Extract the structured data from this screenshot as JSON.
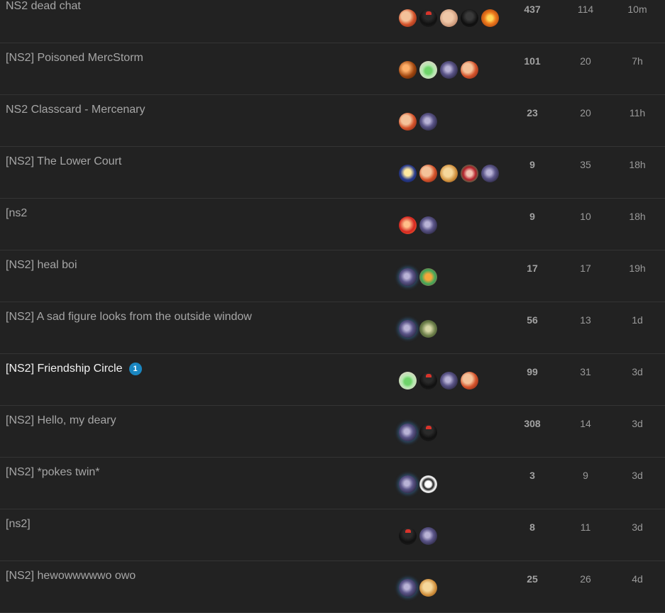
{
  "topics": [
    {
      "title": "NS2 dead chat",
      "badge": "",
      "unread": false,
      "posters": [
        "a",
        "b",
        "c",
        "d",
        "e"
      ],
      "replies": "437",
      "views": "114",
      "activity": "10m"
    },
    {
      "title": "[NS2] Poisoned MercStorm",
      "badge": "",
      "unread": false,
      "posters": [
        "f",
        "g",
        "h",
        "a"
      ],
      "replies": "101",
      "views": "20",
      "activity": "7h"
    },
    {
      "title": "NS2 Classcard - Mercenary",
      "badge": "",
      "unread": false,
      "posters": [
        "a",
        "h"
      ],
      "replies": "23",
      "views": "20",
      "activity": "11h"
    },
    {
      "title": "[NS2] The Lower Court",
      "badge": "",
      "unread": false,
      "posters": [
        "i",
        "a",
        "j",
        "k",
        "h"
      ],
      "replies": "9",
      "views": "35",
      "activity": "18h"
    },
    {
      "title": "[ns2",
      "badge": "",
      "unread": false,
      "posters": [
        "l",
        "h"
      ],
      "replies": "9",
      "views": "10",
      "activity": "18h"
    },
    {
      "title": "[NS2] heal boi",
      "badge": "",
      "unread": false,
      "posters": [
        "h",
        "m"
      ],
      "replies": "17",
      "views": "17",
      "activity": "19h"
    },
    {
      "title": "[NS2] A sad figure looks from the outside window",
      "badge": "",
      "unread": false,
      "posters": [
        "h",
        "n"
      ],
      "replies": "56",
      "views": "13",
      "activity": "1d"
    },
    {
      "title": "[NS2] Friendship Circle",
      "badge": "1",
      "unread": true,
      "posters": [
        "g",
        "b",
        "h",
        "a"
      ],
      "replies": "99",
      "views": "31",
      "activity": "3d"
    },
    {
      "title": "[NS2] Hello, my deary",
      "badge": "",
      "unread": false,
      "posters": [
        "h",
        "b"
      ],
      "replies": "308",
      "views": "14",
      "activity": "3d"
    },
    {
      "title": "[NS2] *pokes twin*",
      "badge": "",
      "unread": false,
      "posters": [
        "h",
        "o"
      ],
      "replies": "3",
      "views": "9",
      "activity": "3d"
    },
    {
      "title": "[ns2]",
      "badge": "",
      "unread": false,
      "posters": [
        "b",
        "h"
      ],
      "replies": "8",
      "views": "11",
      "activity": "3d"
    },
    {
      "title": "[NS2] hewowwwwwo owo",
      "badge": "",
      "unread": false,
      "posters": [
        "h",
        "j"
      ],
      "replies": "25",
      "views": "26",
      "activity": "4d"
    }
  ]
}
